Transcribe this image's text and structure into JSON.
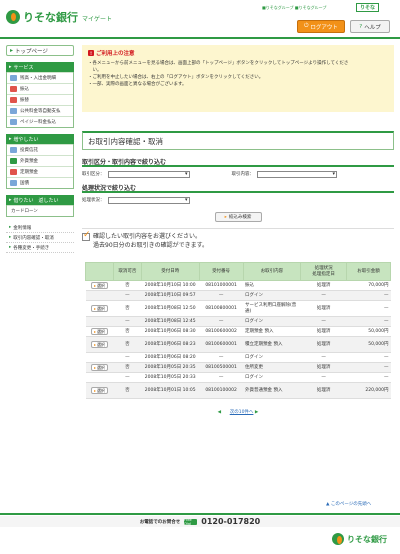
{
  "header": {
    "logo_text": "りそな銀行",
    "logo_sub": "マイゲート",
    "tagline": "■りそなグループ ■りそなグループ",
    "brand_mini": "りそな",
    "logout_label": "ログアウト",
    "help_label": "ヘルプ"
  },
  "sidebar": {
    "top_page": "トップページ",
    "sections": [
      {
        "title": "サービス",
        "items": [
          {
            "label": "残高・入出金明細",
            "color": "#7aa7d8"
          },
          {
            "label": "振込",
            "color": "#e0544b"
          },
          {
            "label": "振替",
            "color": "#e0544b"
          },
          {
            "label": "公共料金等自動支払",
            "color": "#7aa7d8"
          },
          {
            "label": "ペイジー料金払込",
            "color": "#7aa7d8"
          }
        ]
      },
      {
        "title": "増やしたい",
        "items": [
          {
            "label": "投資信託",
            "color": "#7aa7d8"
          },
          {
            "label": "外貨預金",
            "color": "#2f9a44"
          },
          {
            "label": "定期預金",
            "color": "#e0544b"
          },
          {
            "label": "国債",
            "color": "#7aa7d8"
          }
        ]
      },
      {
        "title": "借りたい　返したい",
        "items": [
          {
            "label": "カードローン",
            "color": ""
          }
        ]
      }
    ],
    "links": [
      "金利情報",
      "取引内容確認・取消",
      "各種変更・手続き"
    ]
  },
  "notice": {
    "title": "ご利用上の注意",
    "lines": [
      "・各メニューから前メニューを見る場合は、画面上部の「トップページ」ボタンをクリックしてトップページより操作してくださ",
      "　い。",
      "・ご利用を中止したい場合は、右上の「ログアウト」ボタンをクリックしてください。",
      "・一部、実際の画面と異なる場合がございます。"
    ]
  },
  "page_title": "お取引内容確認・取消",
  "filter_kind": {
    "heading": "取引区分・取引内容で絞り込む",
    "kubun_label": "取引区分：",
    "naiyo_label": "取引内容："
  },
  "filter_status": {
    "heading": "処理状況で絞り込む",
    "status_label": "処理状況："
  },
  "search_button": "絞込み検索",
  "info": {
    "line1": "確認したい取引内容をお選びください。",
    "line2": "過去90日分のお取引きの確認ができます。"
  },
  "table": {
    "headers": [
      "",
      "取消可否",
      "受付日時",
      "受付番号",
      "お取引内容",
      "処理状況\n処理指定日",
      "お取引金額"
    ],
    "select_label": "選択",
    "rows": [
      {
        "sel": true,
        "cancel": "否",
        "date": "2008年10月10日 10:00",
        "no": "08101000001",
        "content": "振込",
        "status": "処理済",
        "amount": "70,000円"
      },
      {
        "sel": false,
        "cancel": "—",
        "date": "2008年10月10日 09:57",
        "no": "—",
        "content": "ログイン",
        "status": "—",
        "amount": "—"
      },
      {
        "sel": true,
        "cancel": "否",
        "date": "2008年10月08日 12:50",
        "no": "08100800001",
        "content": "サービス利用口座解除(普通)",
        "status": "処理済",
        "amount": "—",
        "tall": true
      },
      {
        "sel": false,
        "cancel": "—",
        "date": "2008年10月08日 12:45",
        "no": "—",
        "content": "ログイン",
        "status": "—",
        "amount": "—"
      },
      {
        "sel": true,
        "cancel": "否",
        "date": "2008年10月06日 08:30",
        "no": "08100600002",
        "content": "定期預金 預入",
        "status": "処理済",
        "amount": "50,000円"
      },
      {
        "sel": true,
        "cancel": "否",
        "date": "2008年10月06日 08:23",
        "no": "08100600001",
        "content": "積立定期預金 預入",
        "status": "処理済",
        "amount": "50,000円",
        "tall": true
      },
      {
        "sel": false,
        "cancel": "—",
        "date": "2008年10月06日 08:20",
        "no": "—",
        "content": "ログイン",
        "status": "—",
        "amount": "—"
      },
      {
        "sel": true,
        "cancel": "否",
        "date": "2008年10月05日 20:35",
        "no": "08100500001",
        "content": "住所変更",
        "status": "処理済",
        "amount": "—"
      },
      {
        "sel": false,
        "cancel": "—",
        "date": "2008年10月05日 20:33",
        "no": "—",
        "content": "ログイン",
        "status": "—",
        "amount": "—"
      },
      {
        "sel": true,
        "cancel": "否",
        "date": "2008年10月01日 10:05",
        "no": "08100100002",
        "content": "外貨普通預金 預入",
        "status": "処理済",
        "amount": "220,000円",
        "tall": true
      }
    ]
  },
  "pager": {
    "prev": "◀",
    "next_text": "次の10件へ",
    "next_arrow": "▶"
  },
  "to_top": "▲ このページの先頭へ",
  "footer": {
    "contact_label": "お電話でのお問合せ",
    "freedial": "Free Dial",
    "phone": "0120-017820",
    "logo_text": "りそな銀行"
  }
}
